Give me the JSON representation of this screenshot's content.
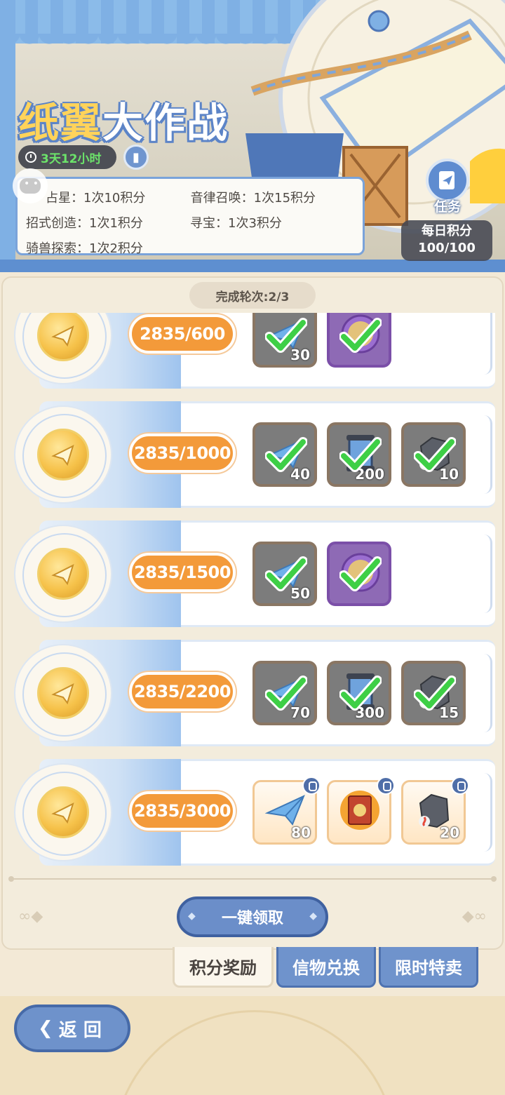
{
  "event": {
    "title_part1": "纸翼",
    "title_part2": "大作战",
    "timer": "3天12小时",
    "info_icon": "book-icon"
  },
  "rules": [
    {
      "name": "占星：",
      "value": "1次10积分"
    },
    {
      "name": "音律召唤：",
      "value": "1次15积分"
    },
    {
      "name": "招式创造：",
      "value": "1次1积分"
    },
    {
      "name": "寻宝：",
      "value": "1次3积分"
    },
    {
      "name": "骑兽探索：",
      "value": "1次2积分"
    }
  ],
  "task": {
    "label": "任务",
    "icon": "task-book-icon"
  },
  "daily": {
    "label": "每日积分",
    "value": "100/100"
  },
  "rounds": "完成轮次:2/3",
  "tiers": [
    {
      "progress": "2835/600",
      "rewards": [
        {
          "type": "paper-plane",
          "qty": "30",
          "claimed": true
        },
        {
          "type": "purple-medal",
          "qty": "",
          "claimed": true
        }
      ]
    },
    {
      "progress": "2835/1000",
      "rewards": [
        {
          "type": "paper-plane",
          "qty": "40",
          "claimed": true
        },
        {
          "type": "scroll",
          "qty": "200",
          "claimed": true
        },
        {
          "type": "ore",
          "qty": "10",
          "claimed": true
        }
      ]
    },
    {
      "progress": "2835/1500",
      "rewards": [
        {
          "type": "paper-plane",
          "qty": "50",
          "claimed": true
        },
        {
          "type": "purple-medal",
          "qty": "",
          "claimed": true
        }
      ]
    },
    {
      "progress": "2835/2200",
      "rewards": [
        {
          "type": "paper-plane",
          "qty": "70",
          "claimed": true
        },
        {
          "type": "scroll",
          "qty": "300",
          "claimed": true
        },
        {
          "type": "ore",
          "qty": "15",
          "claimed": true
        }
      ]
    },
    {
      "progress": "2835/3000",
      "rewards": [
        {
          "type": "paper-plane",
          "qty": "80",
          "claimed": false
        },
        {
          "type": "book",
          "qty": "",
          "claimed": false
        },
        {
          "type": "ore",
          "qty": "20",
          "claimed": false
        }
      ]
    }
  ],
  "claim_all": "一键领取",
  "tabs": [
    {
      "label": "积分奖励",
      "active": true
    },
    {
      "label": "信物兑换",
      "active": false
    },
    {
      "label": "限时特卖",
      "active": false
    }
  ],
  "back": "返 回",
  "colors": {
    "accent_blue": "#6b8ec9",
    "score_orange": "#f39a3a",
    "timer_green": "#6ce36a",
    "check_green": "#3ecf46"
  }
}
